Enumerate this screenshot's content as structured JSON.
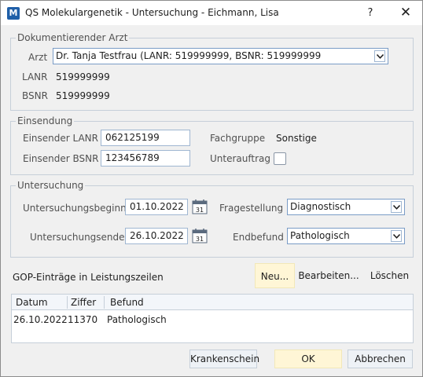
{
  "window": {
    "title": "QS Molekulargenetik - Untersuchung - Eichmann, Lisa",
    "help_label": "?",
    "close_label": "✕",
    "app_icon_label": "M"
  },
  "doc_arzt": {
    "legend": "Dokumentierender Arzt",
    "arzt_label": "Arzt",
    "arzt_value": "Dr. Tanja Testfrau (LANR: 519999999, BSNR: 519999999",
    "lanr_label": "LANR",
    "lanr_value": "519999999",
    "bsnr_label": "BSNR",
    "bsnr_value": "519999999"
  },
  "einsendung": {
    "legend": "Einsendung",
    "lanr_label": "Einsender LANR",
    "lanr_value": "062125199",
    "bsnr_label": "Einsender BSNR",
    "bsnr_value": "123456789",
    "fachgruppe_label": "Fachgruppe",
    "fachgruppe_value": "Sonstige",
    "unterauftrag_label": "Unterauftrag",
    "unterauftrag_checked": false
  },
  "untersuchung": {
    "legend": "Untersuchung",
    "beginn_label": "Untersuchungsbeginn",
    "beginn_value": "01.10.2022",
    "ende_label": "Untersuchungsende",
    "ende_value": "26.10.2022",
    "calendar_day": "31",
    "fragestellung_label": "Fragestellung",
    "fragestellung_value": "Diagnostisch",
    "endbefund_label": "Endbefund",
    "endbefund_value": "Pathologisch"
  },
  "gop": {
    "label": "GOP-Einträge in Leistungszeilen",
    "new_label": "Neu...",
    "edit_label": "Bearbeiten...",
    "delete_label": "Löschen",
    "columns": [
      "Datum",
      "Ziffer",
      "Befund"
    ],
    "rows": [
      {
        "datum": "26.10.2022",
        "ziffer": "11370",
        "befund": "Pathologisch"
      }
    ]
  },
  "footer": {
    "krankenschein_label": "Krankenschein",
    "ok_label": "OK",
    "cancel_label": "Abbrechen"
  },
  "colors": {
    "accent_yellow": "#fff6d6",
    "border_blue": "#7a9cc6",
    "app_icon": "#1f5fa8"
  }
}
